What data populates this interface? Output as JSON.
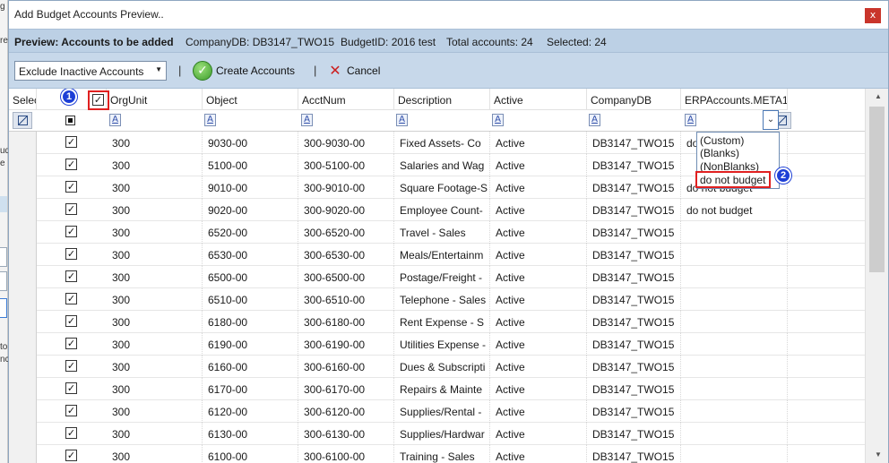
{
  "window": {
    "title": "Add Budget Accounts Preview..",
    "close_label": "x"
  },
  "info": {
    "title": "Preview: Accounts to be added",
    "company_db": "CompanyDB: DB3147_TWO15",
    "budget_id": "BudgetID: 2016 test",
    "total": "Total accounts: 24",
    "selected": "Selected: 24"
  },
  "toolbar": {
    "filter_value": "Exclude Inactive Accounts",
    "create_label": "Create Accounts",
    "cancel_label": "Cancel",
    "separator": "|"
  },
  "columns": {
    "select": "Select",
    "orgunit": "OrgUnit",
    "object": "Object",
    "acctnum": "AcctNum",
    "description": "Description",
    "active": "Active",
    "companydb": "CompanyDB",
    "meta1": "ERPAccounts.META1"
  },
  "filter_glyph": "A",
  "meta_filter_options": [
    "(Custom)",
    "(Blanks)",
    "(NonBlanks)",
    "do not budget"
  ],
  "annotations": {
    "badge1": "1",
    "badge2": "2"
  },
  "rows": [
    {
      "org": "300",
      "obj": "9030-00",
      "acct": "300-9030-00",
      "desc": "Fixed Assets- Co",
      "active": "Active",
      "db": "DB3147_TWO15",
      "meta": "do"
    },
    {
      "org": "300",
      "obj": "5100-00",
      "acct": "300-5100-00",
      "desc": "Salaries and Wag",
      "active": "Active",
      "db": "DB3147_TWO15",
      "meta": ""
    },
    {
      "org": "300",
      "obj": "9010-00",
      "acct": "300-9010-00",
      "desc": "Square Footage-S",
      "active": "Active",
      "db": "DB3147_TWO15",
      "meta": "do not budget"
    },
    {
      "org": "300",
      "obj": "9020-00",
      "acct": "300-9020-00",
      "desc": "Employee Count-",
      "active": "Active",
      "db": "DB3147_TWO15",
      "meta": "do not budget"
    },
    {
      "org": "300",
      "obj": "6520-00",
      "acct": "300-6520-00",
      "desc": "Travel - Sales",
      "active": "Active",
      "db": "DB3147_TWO15",
      "meta": ""
    },
    {
      "org": "300",
      "obj": "6530-00",
      "acct": "300-6530-00",
      "desc": "Meals/Entertainm",
      "active": "Active",
      "db": "DB3147_TWO15",
      "meta": ""
    },
    {
      "org": "300",
      "obj": "6500-00",
      "acct": "300-6500-00",
      "desc": "Postage/Freight -",
      "active": "Active",
      "db": "DB3147_TWO15",
      "meta": ""
    },
    {
      "org": "300",
      "obj": "6510-00",
      "acct": "300-6510-00",
      "desc": "Telephone - Sales",
      "active": "Active",
      "db": "DB3147_TWO15",
      "meta": ""
    },
    {
      "org": "300",
      "obj": "6180-00",
      "acct": "300-6180-00",
      "desc": "Rent Expense - S",
      "active": "Active",
      "db": "DB3147_TWO15",
      "meta": ""
    },
    {
      "org": "300",
      "obj": "6190-00",
      "acct": "300-6190-00",
      "desc": "Utilities Expense -",
      "active": "Active",
      "db": "DB3147_TWO15",
      "meta": ""
    },
    {
      "org": "300",
      "obj": "6160-00",
      "acct": "300-6160-00",
      "desc": "Dues & Subscripti",
      "active": "Active",
      "db": "DB3147_TWO15",
      "meta": ""
    },
    {
      "org": "300",
      "obj": "6170-00",
      "acct": "300-6170-00",
      "desc": "Repairs & Mainte",
      "active": "Active",
      "db": "DB3147_TWO15",
      "meta": ""
    },
    {
      "org": "300",
      "obj": "6120-00",
      "acct": "300-6120-00",
      "desc": "Supplies/Rental -",
      "active": "Active",
      "db": "DB3147_TWO15",
      "meta": ""
    },
    {
      "org": "300",
      "obj": "6130-00",
      "acct": "300-6130-00",
      "desc": "Supplies/Hardwar",
      "active": "Active",
      "db": "DB3147_TWO15",
      "meta": ""
    },
    {
      "org": "300",
      "obj": "6100-00",
      "acct": "300-6100-00",
      "desc": "Training - Sales",
      "active": "Active",
      "db": "DB3147_TWO15",
      "meta": ""
    }
  ],
  "checkbox_glyph": "✓",
  "background_fragments": [
    "g",
    "re",
    "ud",
    "e",
    "to",
    "nc"
  ]
}
